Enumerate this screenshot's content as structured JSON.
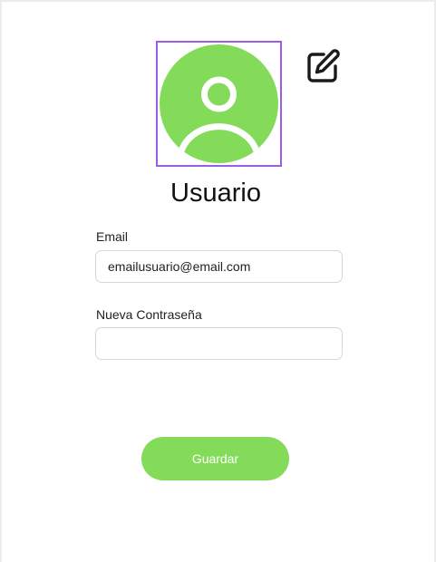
{
  "profile": {
    "username": "Usuario",
    "avatar_icon": "user-avatar-icon",
    "edit_icon": "edit-icon"
  },
  "form": {
    "email_label": "Email",
    "email_value": "emailusuario@email.com",
    "password_label": "Nueva Contraseña",
    "password_value": "",
    "save_label": "Guardar"
  },
  "colors": {
    "accent": "#84db5a",
    "selection_border": "#9b5de5"
  }
}
